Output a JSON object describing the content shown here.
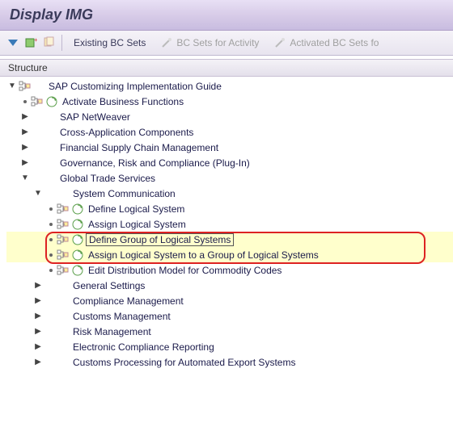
{
  "title": "Display IMG",
  "toolbar": {
    "existing_bc_sets": "Existing BC Sets",
    "bc_sets_activity": "BC Sets for Activity",
    "activated_bc_sets": "Activated BC Sets fo"
  },
  "structure_label": "Structure",
  "tree": {
    "root": "SAP Customizing Implementation Guide",
    "activate_business": "Activate Business Functions",
    "sap_netweaver": "SAP NetWeaver",
    "cross_app": "Cross-Application Components",
    "fscm": "Financial Supply Chain Management",
    "grc": "Governance, Risk and Compliance (Plug-In)",
    "gts": "Global Trade Services",
    "sys_comm": "System Communication",
    "define_ls": "Define Logical System",
    "assign_ls": "Assign Logical System",
    "define_group": "Define Group of Logical Systems",
    "assign_group": "Assign Logical System to a Group of Logical Systems",
    "edit_dist": "Edit Distribution Model for Commodity Codes",
    "general_settings": "General Settings",
    "compliance": "Compliance Management",
    "customs": "Customs Management",
    "risk": "Risk Management",
    "ecr": "Electronic Compliance Reporting",
    "customs_auto": "Customs Processing for Automated Export Systems"
  }
}
